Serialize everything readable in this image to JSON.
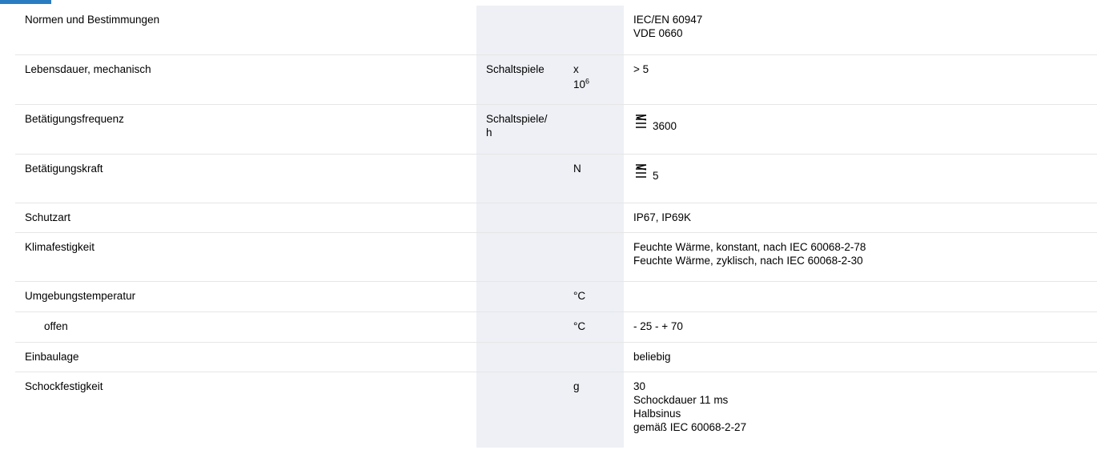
{
  "rows": [
    {
      "label": "Normen und Bestimmungen",
      "unit1": "",
      "unit2": "",
      "values": [
        "IEC/EN 60947",
        "VDE 0660"
      ]
    },
    {
      "label": "Lebensdauer, mechanisch",
      "unit1": "Schaltspiele",
      "unit2_base": "x",
      "unit2_pow_base": "10",
      "unit2_exp": "6",
      "values": [
        "> 5"
      ]
    },
    {
      "label": "Betätigungsfrequenz",
      "unit1": "Schaltspiele/ h",
      "unit2": "",
      "value_symbol": "less-equal-icon",
      "value_num": "3600"
    },
    {
      "label": "Betätigungskraft",
      "unit1": "",
      "unit2": "N",
      "value_symbol": "less-equal-icon",
      "value_num": "5"
    },
    {
      "label": "Schutzart",
      "unit1": "",
      "unit2": "",
      "values": [
        "IP67, IP69K"
      ]
    },
    {
      "label": "Klimafestigkeit",
      "unit1": "",
      "unit2": "",
      "values": [
        "Feuchte Wärme, konstant, nach IEC 60068-2-78",
        "Feuchte Wärme, zyklisch, nach IEC 60068-2-30"
      ]
    },
    {
      "label": "Umgebungstemperatur",
      "unit1": "",
      "unit2": "°C",
      "values": []
    },
    {
      "label": "offen",
      "unit1": "",
      "unit2": "°C",
      "values": [
        "- 25 - + 70"
      ]
    },
    {
      "label": "Einbaulage",
      "unit1": "",
      "unit2": "",
      "values": [
        "beliebig"
      ]
    },
    {
      "label": "Schockfestigkeit",
      "unit1": "",
      "unit2": "g",
      "values": [
        "30",
        "Schockdauer 11 ms",
        "Halbsinus",
        "gemäß IEC 60068-2-27"
      ]
    }
  ],
  "colors": {
    "accent": "#2a7cc0",
    "unit_column_bg": "#eef0f5",
    "row_divider": "#e6e6e6"
  }
}
